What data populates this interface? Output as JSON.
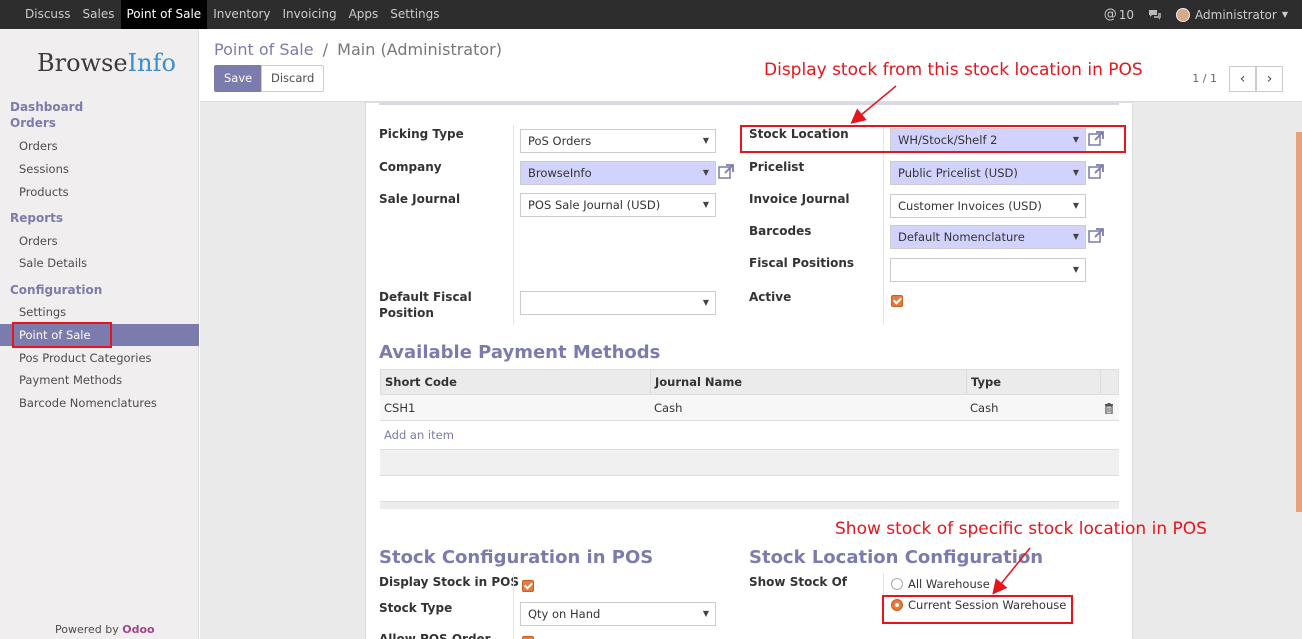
{
  "topbar": {
    "menu": [
      "Discuss",
      "Sales",
      "Point of Sale",
      "Inventory",
      "Invoicing",
      "Apps",
      "Settings"
    ],
    "active_menu": "Point of Sale",
    "messages_count": "10",
    "user": "Administrator"
  },
  "sidebar": {
    "logo_main": "Browse",
    "logo_accent": "Info",
    "sections": [
      {
        "title": "Dashboard",
        "items": []
      },
      {
        "title": "Orders",
        "items": [
          "Orders",
          "Sessions",
          "Products"
        ]
      },
      {
        "title": "Reports",
        "items": [
          "Orders",
          "Sale Details"
        ]
      },
      {
        "title": "Configuration",
        "items": [
          "Settings",
          "Point of Sale",
          "Pos Product Categories",
          "Payment Methods",
          "Barcode Nomenclatures"
        ]
      }
    ],
    "active_item": "Point of Sale",
    "powered_by": "Powered by",
    "powered_brand": "Odoo"
  },
  "control_panel": {
    "breadcrumb_root": "Point of Sale",
    "breadcrumb_sep": "/",
    "breadcrumb_current": "Main (Administrator)",
    "save_label": "Save",
    "discard_label": "Discard",
    "pager": "1 / 1"
  },
  "form": {
    "left": {
      "picking_type_label": "Picking Type",
      "picking_type_value": "PoS Orders",
      "company_label": "Company",
      "company_value": "BrowseInfo",
      "sale_journal_label": "Sale Journal",
      "sale_journal_value": "POS Sale Journal (USD)",
      "fiscal_position_label_1": "Default Fiscal",
      "fiscal_position_label_2": "Position",
      "fiscal_position_value": ""
    },
    "right": {
      "stock_location_label": "Stock Location",
      "stock_location_value": "WH/Stock/Shelf 2",
      "pricelist_label": "Pricelist",
      "pricelist_value": "Public Pricelist (USD)",
      "invoice_journal_label": "Invoice Journal",
      "invoice_journal_value": "Customer Invoices (USD)",
      "barcodes_label": "Barcodes",
      "barcodes_value": "Default Nomenclature",
      "fiscal_positions_label": "Fiscal Positions",
      "fiscal_positions_value": "",
      "active_label": "Active",
      "active_checked": true
    },
    "payment": {
      "title": "Available Payment Methods",
      "columns": [
        "Short Code",
        "Journal Name",
        "Type"
      ],
      "rows": [
        [
          "CSH1",
          "Cash",
          "Cash"
        ]
      ],
      "add_item": "Add an item"
    },
    "stock_config": {
      "title": "Stock Configuration in POS",
      "display_stock_label": "Display Stock in POS",
      "display_stock_checked": true,
      "stock_type_label": "Stock Type",
      "stock_type_value": "Qty on Hand",
      "allow_pos_order_label": "Allow POS Order"
    },
    "stock_location_config": {
      "title": "Stock Location Configuration",
      "show_stock_of_label": "Show Stock Of",
      "options": [
        "All Warehouse",
        "Current Session Warehouse"
      ],
      "selected": "Current Session Warehouse"
    }
  },
  "annotations": {
    "top": "Display stock from this stock location in POS",
    "bottom": "Show stock of specific stock location in POS"
  },
  "colors": {
    "accent": "#7c7bad",
    "annotation": "#e6141c",
    "checkbox": "#e7793a",
    "required_field": "#d2d2ff"
  }
}
